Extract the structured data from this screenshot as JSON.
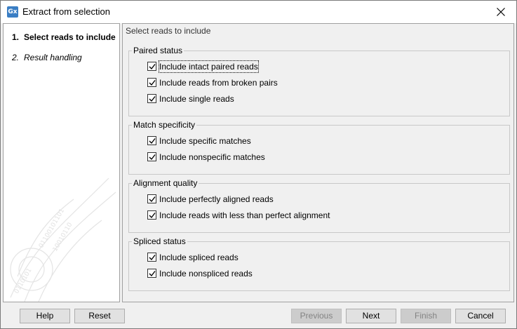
{
  "window": {
    "title": "Extract from selection",
    "icon_text": "Gx"
  },
  "steps": [
    {
      "number": "1.",
      "label": "Select reads to include"
    },
    {
      "number": "2.",
      "label": "Result handling"
    }
  ],
  "main": {
    "header": "Select reads to include",
    "groups": [
      {
        "legend": "Paired status",
        "options": [
          {
            "label": "Include intact paired reads",
            "checked": true
          },
          {
            "label": "Include reads from broken pairs",
            "checked": true
          },
          {
            "label": "Include single reads",
            "checked": true
          }
        ]
      },
      {
        "legend": "Match specificity",
        "options": [
          {
            "label": "Include specific matches",
            "checked": true
          },
          {
            "label": "Include nonspecific matches",
            "checked": true
          }
        ]
      },
      {
        "legend": "Alignment quality",
        "options": [
          {
            "label": "Include perfectly aligned reads",
            "checked": true
          },
          {
            "label": "Include reads with less than perfect alignment",
            "checked": true
          }
        ]
      },
      {
        "legend": "Spliced status",
        "options": [
          {
            "label": "Include spliced reads",
            "checked": true
          },
          {
            "label": "Include nonspliced reads",
            "checked": true
          }
        ]
      }
    ]
  },
  "buttons": {
    "help": "Help",
    "reset": "Reset",
    "previous": "Previous",
    "next": "Next",
    "finish": "Finish",
    "cancel": "Cancel"
  }
}
